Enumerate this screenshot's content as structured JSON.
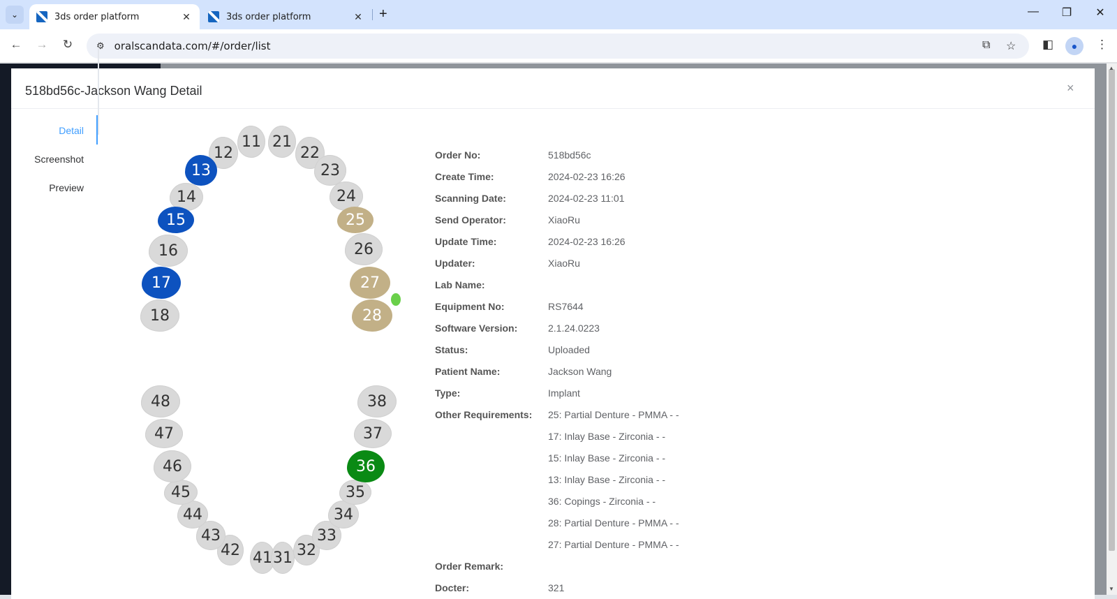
{
  "browser": {
    "tabs": [
      {
        "title": "3ds order platform",
        "active": true
      },
      {
        "title": "3ds order platform",
        "active": false
      }
    ],
    "url": "oralscandata.com/#/order/list"
  },
  "modal": {
    "title": "518bd56c-Jackson Wang Detail",
    "close_symbol": "×"
  },
  "side_tabs": [
    "Detail",
    "Screenshot",
    "Preview"
  ],
  "teeth": {
    "upper": [
      "11",
      "12",
      "13",
      "14",
      "15",
      "16",
      "17",
      "18",
      "21",
      "22",
      "23",
      "24",
      "25",
      "26",
      "27",
      "28"
    ],
    "lower": [
      "31",
      "32",
      "33",
      "34",
      "35",
      "36",
      "37",
      "38",
      "41",
      "42",
      "43",
      "44",
      "45",
      "46",
      "47",
      "48"
    ],
    "highlight_colors": {
      "blue": "#0d52bf",
      "tan": "#c2b087",
      "green": "#0a8a14",
      "default": "#d9d9d9"
    },
    "blue": [
      "13",
      "15",
      "17"
    ],
    "tan": [
      "25",
      "27",
      "28"
    ],
    "green": [
      "36"
    ]
  },
  "details": [
    {
      "label": "Order No:",
      "value": "518bd56c"
    },
    {
      "label": "Create Time:",
      "value": "2024-02-23 16:26"
    },
    {
      "label": "Scanning Date:",
      "value": "2024-02-23 11:01"
    },
    {
      "label": "Send Operator:",
      "value": "XiaoRu"
    },
    {
      "label": "Update Time:",
      "value": "2024-02-23 16:26"
    },
    {
      "label": "Updater:",
      "value": "XiaoRu"
    },
    {
      "label": "Lab Name:",
      "value": ""
    },
    {
      "label": "Equipment No:",
      "value": "RS7644"
    },
    {
      "label": "Software Version:",
      "value": "2.1.24.0223"
    },
    {
      "label": "Status:",
      "value": "Uploaded"
    },
    {
      "label": "Patient Name:",
      "value": "Jackson Wang"
    },
    {
      "label": "Type:",
      "value": "Implant"
    },
    {
      "label": "Other Requirements:",
      "value": "25: Partial Denture - PMMA - -"
    }
  ],
  "other_requirements_more": [
    "17: Inlay Base - Zirconia - -",
    "15: Inlay Base - Zirconia - -",
    "13: Inlay Base - Zirconia - -",
    "36: Copings - Zirconia - -",
    "28: Partial Denture - PMMA - -",
    "27: Partial Denture - PMMA - -"
  ],
  "tail": [
    {
      "label": "Order Remark:",
      "value": ""
    },
    {
      "label": "Docter:",
      "value": "321"
    }
  ]
}
